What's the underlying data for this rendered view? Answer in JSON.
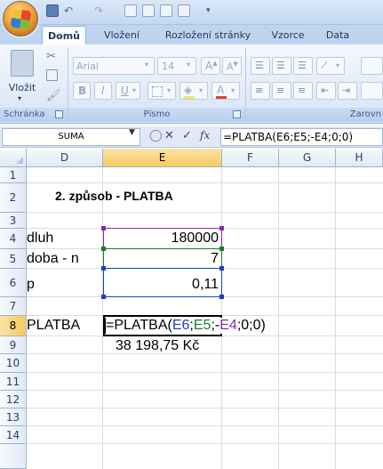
{
  "quick_access": {
    "icons": [
      "save-icon",
      "undo-icon",
      "redo-icon",
      "print-preview-icon",
      "customize-icon"
    ]
  },
  "tabs": [
    {
      "label": "Domů",
      "active": true
    },
    {
      "label": "Vložení"
    },
    {
      "label": "Rozložení stránky"
    },
    {
      "label": "Vzorce"
    },
    {
      "label": "Data"
    }
  ],
  "ribbon": {
    "paste_label": "Vložit",
    "font_name": "Arial",
    "font_size": "14",
    "bold": "B",
    "italic": "I",
    "underline": "U",
    "groups": {
      "clipboard": "Schránka",
      "font": "Písmo",
      "alignment": "Zarovn"
    }
  },
  "formula_bar": {
    "name_box": "SUMA",
    "formula": "=PLATBA(E6;E5;-E4;0;0)",
    "fx": "fx"
  },
  "columns": [
    "D",
    "E",
    "F",
    "G",
    "H"
  ],
  "rows": [
    "1",
    "2",
    "3",
    "4",
    "5",
    "6",
    "7",
    "8",
    "9",
    "10",
    "11",
    "12",
    "13",
    "14"
  ],
  "cells": {
    "title": "2. způsob - PLATBA",
    "d4": "dluh",
    "e4": "180000",
    "d5": "doba - n",
    "e5": "7",
    "d6": "p",
    "e6": "0,11",
    "d8": "PLATBA",
    "e8_prefix": "=PLATBA(",
    "e8_ref1": "E6",
    "e8_sep1": ";",
    "e8_ref2": "E5",
    "e8_sep2": ";-",
    "e8_ref3": "E4",
    "e8_suffix": ";0;0)",
    "e9": "38 198,75 Kč"
  },
  "colors": {
    "ref_e6": "#1f3ec8",
    "ref_e5": "#1e7a2c",
    "ref_e4": "#8a2aa8"
  }
}
